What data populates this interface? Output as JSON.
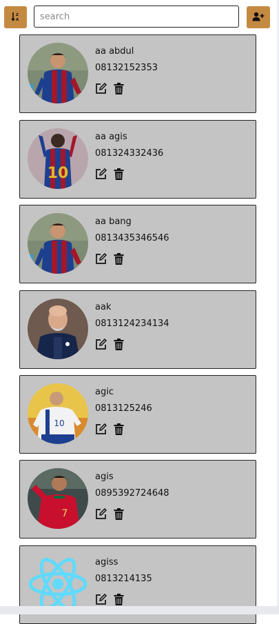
{
  "toolbar": {
    "sort_icon": "sort-descending-icon",
    "add_icon": "add-user-icon",
    "search_placeholder": "search",
    "accent": "#c48a42"
  },
  "contacts": [
    {
      "name": "aa abdul",
      "phone": "08132152353",
      "avatar": "barcelona-player"
    },
    {
      "name": "aa agis",
      "phone": "081324332436",
      "avatar": "barcelona-player-back"
    },
    {
      "name": "aa bang",
      "phone": "0813435346546",
      "avatar": "barcelona-player"
    },
    {
      "name": "aak",
      "phone": "0813124234134",
      "avatar": "coach"
    },
    {
      "name": "agic",
      "phone": "0813125246",
      "avatar": "france-player"
    },
    {
      "name": "agis",
      "phone": "0895392724648",
      "avatar": "portugal-player"
    },
    {
      "name": "agiss",
      "phone": "0813214135",
      "avatar": "react-logo"
    }
  ],
  "card_actions": {
    "edit_icon": "edit-icon",
    "delete_icon": "trash-icon"
  }
}
